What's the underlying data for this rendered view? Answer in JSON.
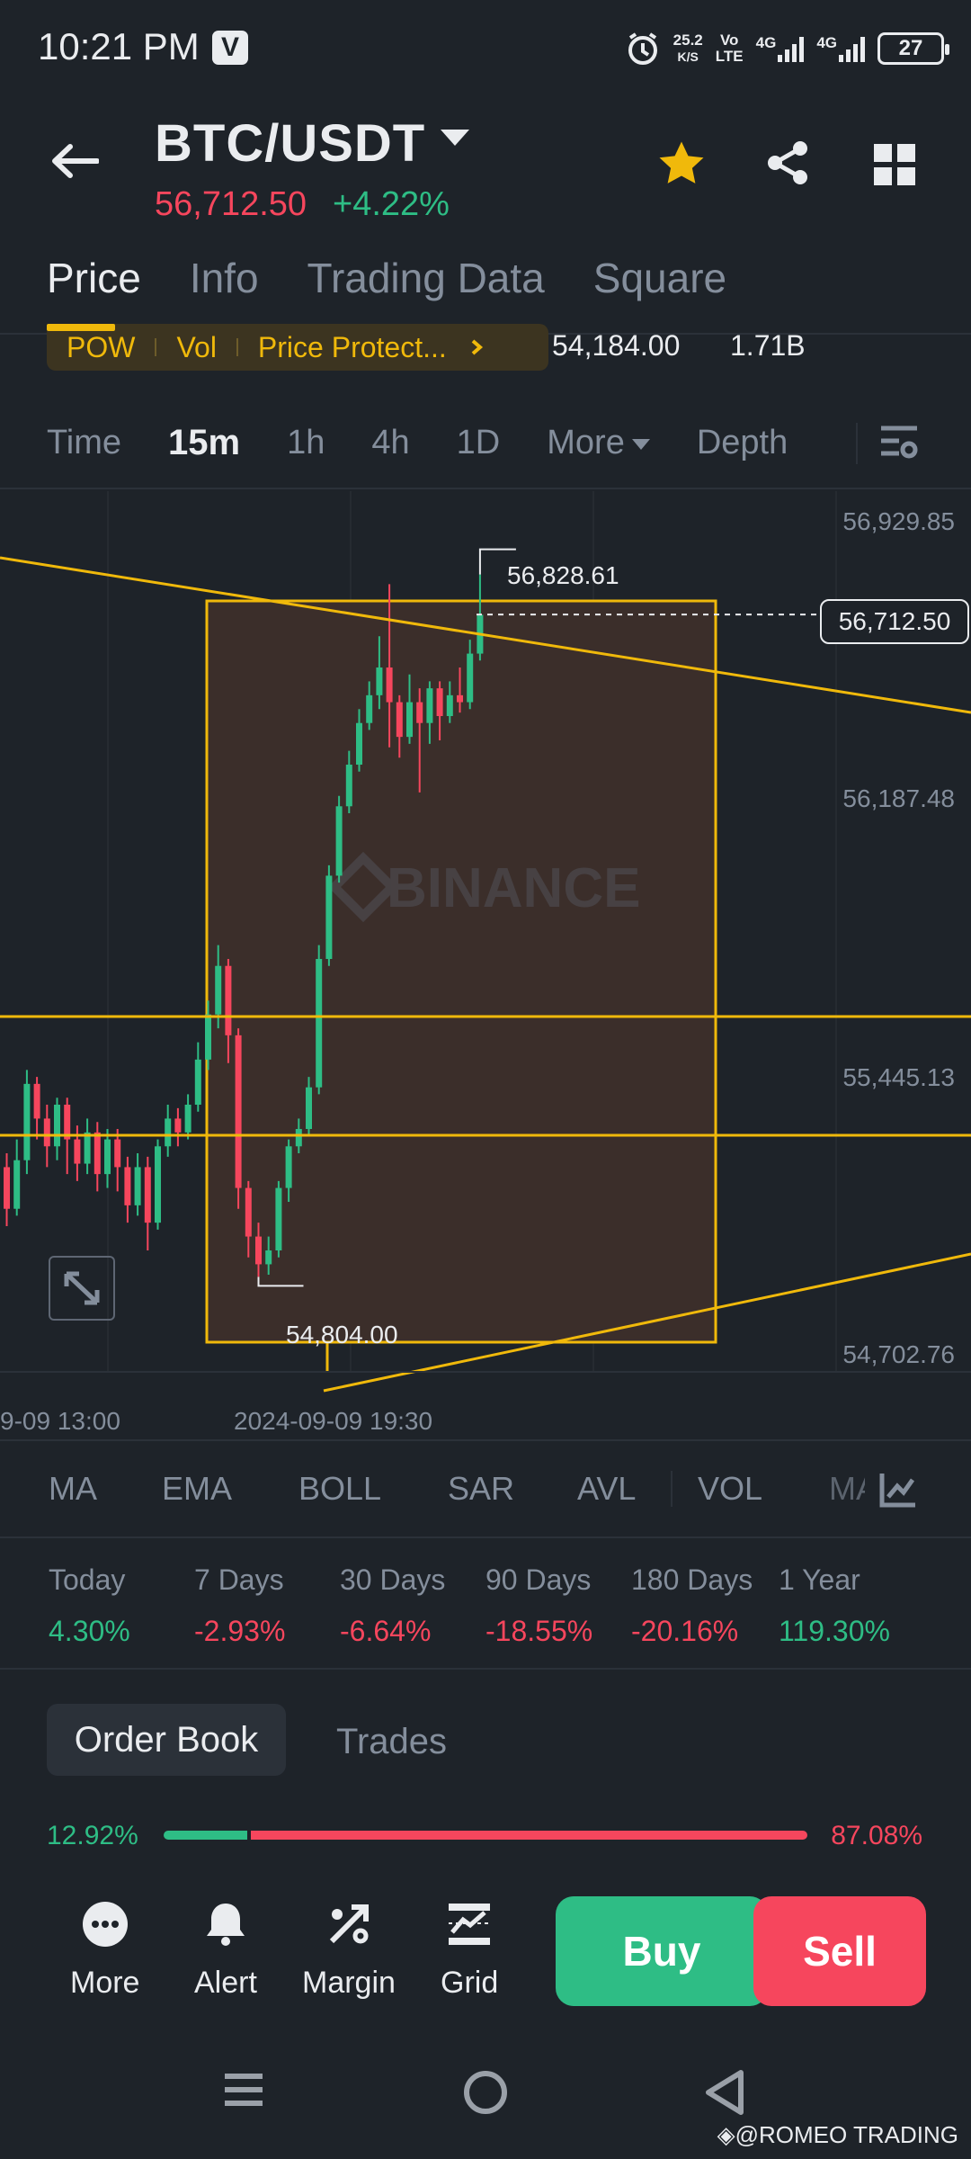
{
  "status_bar": {
    "time": "10:21 PM",
    "v_badge": "V",
    "net_speed_top": "25.2",
    "net_speed_bottom": "K/S",
    "volte_top": "Vo",
    "volte_bottom": "LTE",
    "sim1": "4G",
    "sim2": "4G",
    "battery": "27"
  },
  "header": {
    "pair": "BTC/USDT",
    "price": "56,712.50",
    "change": "+4.22%"
  },
  "tabs": [
    "Price",
    "Info",
    "Trading Data",
    "Square"
  ],
  "tag_strip": {
    "tags": [
      "POW",
      "Vol",
      "Price Protect..."
    ],
    "value1": "54,184.00",
    "value2": "1.71B"
  },
  "intervals": {
    "items": [
      "Time",
      "15m",
      "1h",
      "4h",
      "1D"
    ],
    "more": "More",
    "depth": "Depth"
  },
  "chart_data": {
    "type": "candlestick",
    "y_ticks": [
      "56,929.85",
      "56,187.48",
      "55,445.13",
      "54,702.76"
    ],
    "x_ticks": [
      "9-09 13:00",
      "2024-09-09 19:30"
    ],
    "current_price": "56,712.50",
    "high_label": "56,828.61",
    "low_label": "54,804.00",
    "watermark": "BINANCE",
    "ylim": [
      54600,
      56980
    ],
    "candles": [
      {
        "o": 55120,
        "c": 55000,
        "h": 55160,
        "l": 54950
      },
      {
        "o": 55000,
        "c": 55140,
        "h": 55200,
        "l": 54980
      },
      {
        "o": 55140,
        "c": 55360,
        "h": 55400,
        "l": 55100
      },
      {
        "o": 55360,
        "c": 55260,
        "h": 55380,
        "l": 55200
      },
      {
        "o": 55260,
        "c": 55180,
        "h": 55300,
        "l": 55120
      },
      {
        "o": 55180,
        "c": 55300,
        "h": 55320,
        "l": 55140
      },
      {
        "o": 55300,
        "c": 55200,
        "h": 55320,
        "l": 55100
      },
      {
        "o": 55200,
        "c": 55130,
        "h": 55240,
        "l": 55080
      },
      {
        "o": 55130,
        "c": 55220,
        "h": 55260,
        "l": 55100
      },
      {
        "o": 55220,
        "c": 55100,
        "h": 55250,
        "l": 55050
      },
      {
        "o": 55100,
        "c": 55200,
        "h": 55230,
        "l": 55060
      },
      {
        "o": 55200,
        "c": 55120,
        "h": 55230,
        "l": 55050
      },
      {
        "o": 55120,
        "c": 55010,
        "h": 55150,
        "l": 54960
      },
      {
        "o": 55010,
        "c": 55120,
        "h": 55160,
        "l": 54980
      },
      {
        "o": 55120,
        "c": 54960,
        "h": 55150,
        "l": 54880
      },
      {
        "o": 54960,
        "c": 55180,
        "h": 55200,
        "l": 54940
      },
      {
        "o": 55180,
        "c": 55260,
        "h": 55300,
        "l": 55150
      },
      {
        "o": 55260,
        "c": 55220,
        "h": 55290,
        "l": 55180
      },
      {
        "o": 55220,
        "c": 55300,
        "h": 55330,
        "l": 55200
      },
      {
        "o": 55300,
        "c": 55430,
        "h": 55480,
        "l": 55280
      },
      {
        "o": 55430,
        "c": 55560,
        "h": 55600,
        "l": 55400
      },
      {
        "o": 55560,
        "c": 55700,
        "h": 55760,
        "l": 55520
      },
      {
        "o": 55700,
        "c": 55500,
        "h": 55720,
        "l": 55420
      },
      {
        "o": 55500,
        "c": 55060,
        "h": 55520,
        "l": 55000
      },
      {
        "o": 55060,
        "c": 54920,
        "h": 55080,
        "l": 54860
      },
      {
        "o": 54920,
        "c": 54840,
        "h": 54960,
        "l": 54804
      },
      {
        "o": 54840,
        "c": 54880,
        "h": 54920,
        "l": 54810
      },
      {
        "o": 54880,
        "c": 55060,
        "h": 55080,
        "l": 54860
      },
      {
        "o": 55060,
        "c": 55180,
        "h": 55200,
        "l": 55020
      },
      {
        "o": 55180,
        "c": 55230,
        "h": 55260,
        "l": 55160
      },
      {
        "o": 55230,
        "c": 55350,
        "h": 55380,
        "l": 55210
      },
      {
        "o": 55350,
        "c": 55720,
        "h": 55760,
        "l": 55330
      },
      {
        "o": 55720,
        "c": 55960,
        "h": 55990,
        "l": 55700
      },
      {
        "o": 55960,
        "c": 56160,
        "h": 56190,
        "l": 55940
      },
      {
        "o": 56160,
        "c": 56280,
        "h": 56320,
        "l": 56140
      },
      {
        "o": 56280,
        "c": 56400,
        "h": 56440,
        "l": 56260
      },
      {
        "o": 56400,
        "c": 56480,
        "h": 56520,
        "l": 56380
      },
      {
        "o": 56480,
        "c": 56560,
        "h": 56650,
        "l": 56440
      },
      {
        "o": 56560,
        "c": 56460,
        "h": 56800,
        "l": 56330
      },
      {
        "o": 56460,
        "c": 56360,
        "h": 56480,
        "l": 56300
      },
      {
        "o": 56360,
        "c": 56460,
        "h": 56540,
        "l": 56340
      },
      {
        "o": 56460,
        "c": 56400,
        "h": 56500,
        "l": 56200
      },
      {
        "o": 56400,
        "c": 56500,
        "h": 56520,
        "l": 56340
      },
      {
        "o": 56500,
        "c": 56420,
        "h": 56520,
        "l": 56350
      },
      {
        "o": 56420,
        "c": 56480,
        "h": 56520,
        "l": 56400
      },
      {
        "o": 56480,
        "c": 56460,
        "h": 56560,
        "l": 56430
      },
      {
        "o": 56460,
        "c": 56600,
        "h": 56640,
        "l": 56440
      },
      {
        "o": 56600,
        "c": 56712,
        "h": 56828,
        "l": 56580
      }
    ]
  },
  "indicators": [
    "MA",
    "EMA",
    "BOLL",
    "SAR",
    "AVL",
    "VOL",
    "MA"
  ],
  "performance": [
    {
      "label": "Today",
      "value": "4.30%",
      "dir": "pos"
    },
    {
      "label": "7 Days",
      "value": "-2.93%",
      "dir": "neg"
    },
    {
      "label": "30 Days",
      "value": "-6.64%",
      "dir": "neg"
    },
    {
      "label": "90 Days",
      "value": "-18.55%",
      "dir": "neg"
    },
    {
      "label": "180 Days",
      "value": "-20.16%",
      "dir": "neg"
    },
    {
      "label": "1 Year",
      "value": "119.30%",
      "dir": "pos"
    }
  ],
  "order_book": {
    "tab1": "Order Book",
    "tab2": "Trades",
    "bid_ratio": "12.92%",
    "ask_ratio": "87.08%",
    "bid_fraction": 0.1292
  },
  "actions": [
    "More",
    "Alert",
    "Margin",
    "Grid"
  ],
  "buttons": {
    "buy": "Buy",
    "sell": "Sell"
  },
  "watermark": "@ROMEO TRADING",
  "colors": {
    "up": "#2ebd85",
    "down": "#f6465d",
    "accent": "#f0b90b",
    "bg": "#1e2329"
  }
}
